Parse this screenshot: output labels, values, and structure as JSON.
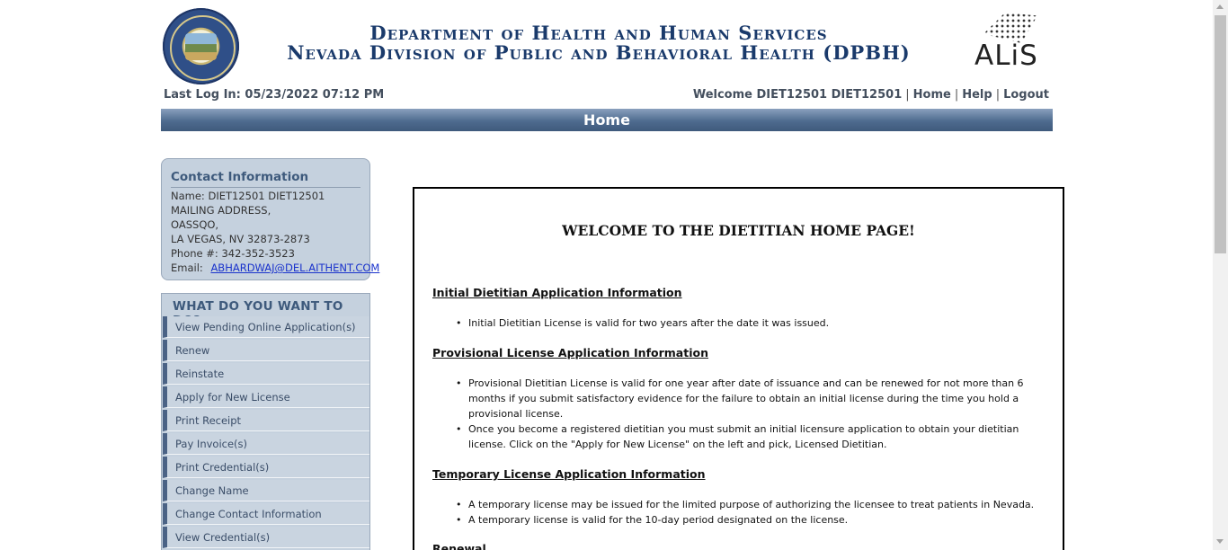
{
  "header": {
    "line1": "Department of Health and Human Services",
    "line2": "Nevada Division of Public and Behavioral Health (DPBH)",
    "alis_logo": "ALiS",
    "last_login": "Last Log In: 05/23/2022 07:12 PM",
    "welcome": "Welcome DIET12501 DIET12501",
    "nav": {
      "home": "Home",
      "help": "Help",
      "logout": "Logout"
    },
    "page_title": "Home"
  },
  "contact": {
    "title": "Contact Information",
    "name": "Name: DIET12501 DIET12501",
    "address1": "MAILING ADDRESS,",
    "address2": "OASSQO,",
    "address3": "LA VEGAS, NV  32873-2873",
    "phone": "Phone #: 342-352-3523",
    "email_label": "Email:",
    "email": "ABHARDWAJ@DEL.AITHENT.COM"
  },
  "actions": {
    "title": "WHAT DO YOU WANT TO DO?",
    "items": [
      "View Pending Online Application(s)",
      "Renew",
      "Reinstate",
      "Apply for New License",
      "Print Receipt",
      "Pay Invoice(s)",
      "Print Credential(s)",
      "Change Name",
      "Change Contact Information",
      "View Credential(s)"
    ]
  },
  "main": {
    "welcome": "WELCOME TO THE DIETITIAN HOME PAGE!",
    "sections": [
      {
        "heading": "Initial Dietitian Application Information",
        "bullets": [
          "Initial Dietitian License is valid for two years after the date it was issued."
        ]
      },
      {
        "heading": "Provisional License Application Information",
        "bullets": [
          "Provisional Dietitian License is valid for one year after date of issuance and can be renewed for not more than 6 months if you submit satisfactory evidence for the failure to obtain an initial license during the time you hold a provisional license.",
          "Once you become a registered dietitian you must submit an initial licensure application to obtain your dietitian license. Click on the \"Apply for New License\" on the left and pick, Licensed Dietitian."
        ]
      },
      {
        "heading": "Temporary License Application Information",
        "bullets": [
          "A temporary license may be issued for the limited purpose of authorizing the licensee to treat patients in Nevada.",
          "A temporary license is valid for the 10-day period designated on the license."
        ]
      },
      {
        "heading": "Renewal",
        "bullets": []
      }
    ]
  }
}
